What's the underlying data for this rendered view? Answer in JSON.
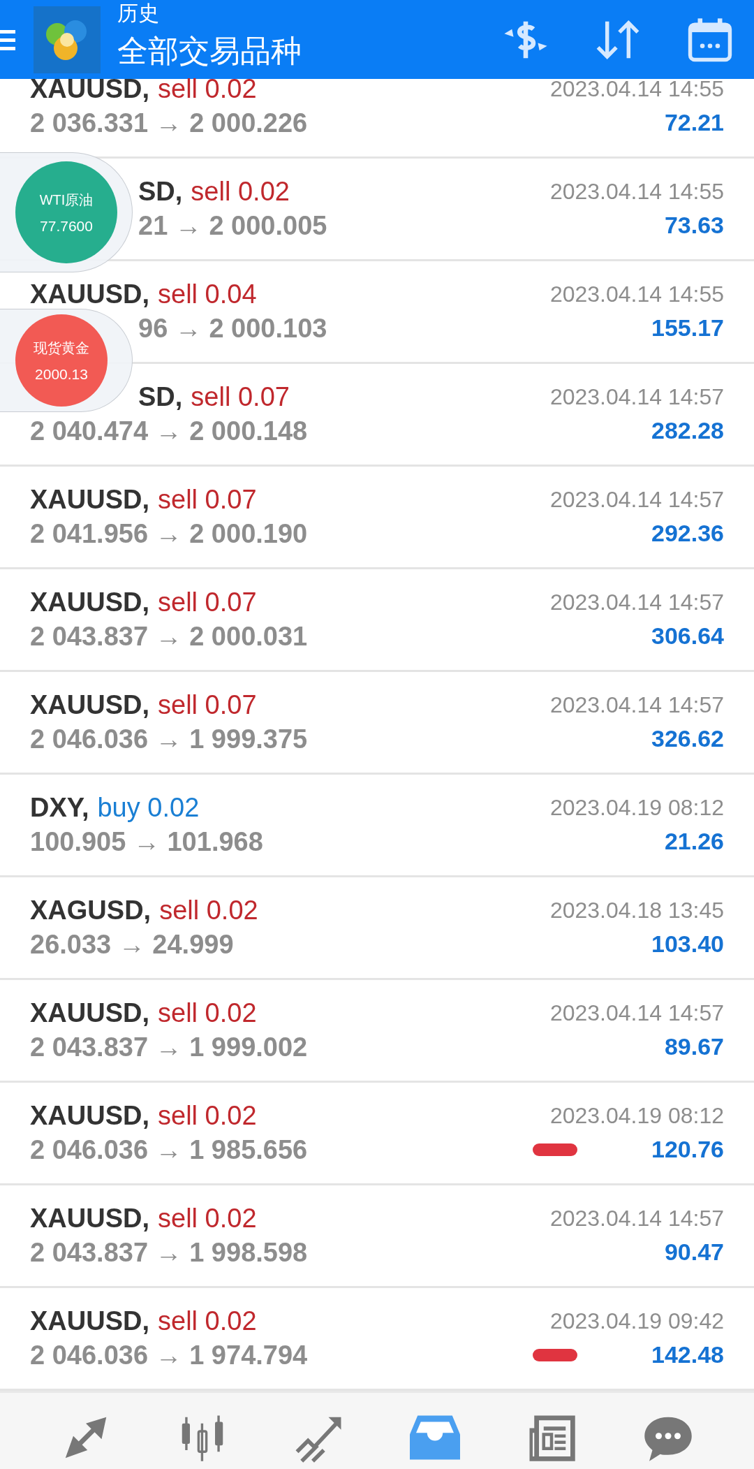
{
  "header": {
    "title": "历史",
    "subtitle": "全部交易品种"
  },
  "deals": [
    {
      "symbol": "XAUUSD,",
      "side": "sell",
      "volume": "0.02",
      "prices": "2 036.331 → 2 000.226",
      "time": "2023.04.14 14:55",
      "profit": "72.21",
      "symbol_covered": false,
      "prices_covered": false,
      "marked": false
    },
    {
      "symbol": "SD,",
      "side": "sell",
      "volume": "0.02",
      "prices": "21 → 2 000.005",
      "time": "2023.04.14 14:55",
      "profit": "73.63",
      "symbol_covered": true,
      "prices_covered": true,
      "marked": false
    },
    {
      "symbol": "XAUUSD,",
      "side": "sell",
      "volume": "0.04",
      "prices": "96 → 2 000.103",
      "time": "2023.04.14 14:55",
      "profit": "155.17",
      "symbol_covered": false,
      "prices_covered": true,
      "marked": false
    },
    {
      "symbol": "SD,",
      "side": "sell",
      "volume": "0.07",
      "prices": "2 040.474 → 2 000.148",
      "time": "2023.04.14 14:57",
      "profit": "282.28",
      "symbol_covered": true,
      "prices_covered": false,
      "marked": false
    },
    {
      "symbol": "XAUUSD,",
      "side": "sell",
      "volume": "0.07",
      "prices": "2 041.956 → 2 000.190",
      "time": "2023.04.14 14:57",
      "profit": "292.36",
      "symbol_covered": false,
      "prices_covered": false,
      "marked": false
    },
    {
      "symbol": "XAUUSD,",
      "side": "sell",
      "volume": "0.07",
      "prices": "2 043.837 → 2 000.031",
      "time": "2023.04.14 14:57",
      "profit": "306.64",
      "symbol_covered": false,
      "prices_covered": false,
      "marked": false
    },
    {
      "symbol": "XAUUSD,",
      "side": "sell",
      "volume": "0.07",
      "prices": "2 046.036 → 1 999.375",
      "time": "2023.04.14 14:57",
      "profit": "326.62",
      "symbol_covered": false,
      "prices_covered": false,
      "marked": false
    },
    {
      "symbol": "DXY,",
      "side": "buy",
      "volume": "0.02",
      "prices": "100.905 → 101.968",
      "time": "2023.04.19 08:12",
      "profit": "21.26",
      "symbol_covered": false,
      "prices_covered": false,
      "marked": false
    },
    {
      "symbol": "XAGUSD,",
      "side": "sell",
      "volume": "0.02",
      "prices": "26.033 → 24.999",
      "time": "2023.04.18 13:45",
      "profit": "103.40",
      "symbol_covered": false,
      "prices_covered": false,
      "marked": false
    },
    {
      "symbol": "XAUUSD,",
      "side": "sell",
      "volume": "0.02",
      "prices": "2 043.837 → 1 999.002",
      "time": "2023.04.14 14:57",
      "profit": "89.67",
      "symbol_covered": false,
      "prices_covered": false,
      "marked": false
    },
    {
      "symbol": "XAUUSD,",
      "side": "sell",
      "volume": "0.02",
      "prices": "2 046.036 → 1 985.656",
      "time": "2023.04.19 08:12",
      "profit": "120.76",
      "symbol_covered": false,
      "prices_covered": false,
      "marked": true
    },
    {
      "symbol": "XAUUSD,",
      "side": "sell",
      "volume": "0.02",
      "prices": "2 043.837 → 1 998.598",
      "time": "2023.04.14 14:57",
      "profit": "90.47",
      "symbol_covered": false,
      "prices_covered": false,
      "marked": false
    },
    {
      "symbol": "XAUUSD,",
      "side": "sell",
      "volume": "0.02",
      "prices": "2 046.036 → 1 974.794",
      "time": "2023.04.19 09:42",
      "profit": "142.48",
      "symbol_covered": false,
      "prices_covered": false,
      "marked": true
    }
  ],
  "bubbles": [
    {
      "name": "WTI原油",
      "price": "77.7600",
      "color": "#26ae8e"
    },
    {
      "name": "现货黄金",
      "price": "2000.13",
      "color": "#f25a54"
    }
  ],
  "nav": [
    {
      "kind": "quotes",
      "selected": false
    },
    {
      "kind": "chart",
      "selected": false
    },
    {
      "kind": "trade",
      "selected": false
    },
    {
      "kind": "history",
      "selected": true
    },
    {
      "kind": "news",
      "selected": false
    },
    {
      "kind": "chat",
      "selected": false
    }
  ]
}
